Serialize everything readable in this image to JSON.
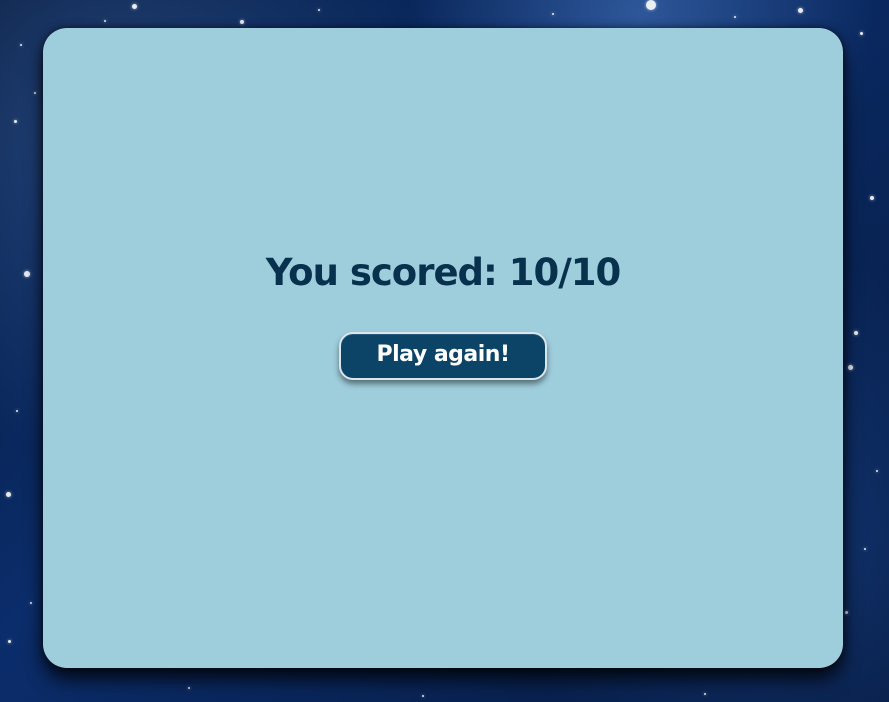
{
  "game": {
    "score_label": "You scored: 10/10",
    "play_again_label": "Play again!"
  },
  "colors": {
    "panel_bg": "#9ecddc",
    "score_text": "#08314d",
    "button_bg": "#0c4468",
    "button_text": "#ffffff",
    "button_border": "#d9e6ee"
  }
}
